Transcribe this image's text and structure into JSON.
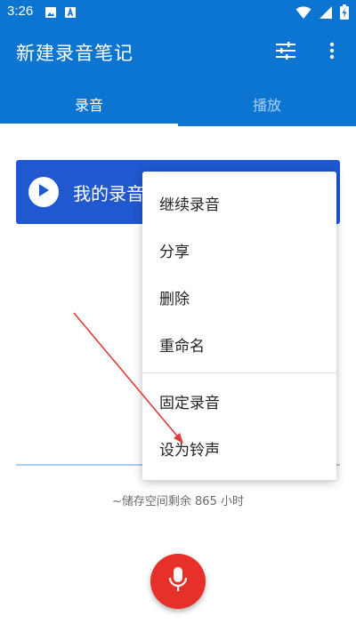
{
  "status_bar": {
    "time": "3:26",
    "left_icons": [
      "image-icon",
      "app-a-icon"
    ],
    "right_icons": [
      "wifi-icon",
      "signal-icon",
      "battery-charging-icon"
    ]
  },
  "app_bar": {
    "title": "新建录音笔记",
    "actions": [
      "tune-icon",
      "more-vert-icon"
    ],
    "color": "#0b75d1"
  },
  "tabs": [
    {
      "label": "录音",
      "active": true
    },
    {
      "label": "播放",
      "active": false
    }
  ],
  "recording": {
    "name": "我的录音",
    "card_color": "#1f58cf"
  },
  "storage": {
    "text": "~储存空间剩余 865 小时"
  },
  "menu": {
    "items": [
      "继续录音",
      "分享",
      "删除",
      "重命名",
      "固定录音",
      "设为铃声"
    ]
  },
  "fab": {
    "icon": "microphone-icon",
    "color": "#e6302a"
  },
  "annotation": {
    "color": "#e03b3b"
  }
}
